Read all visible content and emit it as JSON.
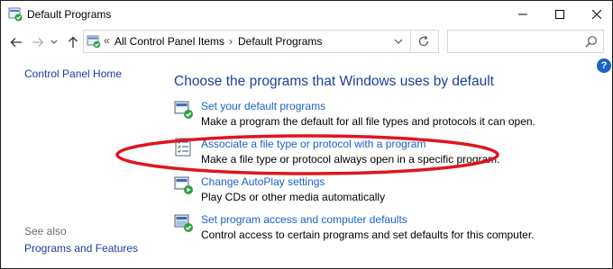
{
  "window": {
    "title": "Default Programs"
  },
  "address": {
    "overflow": "«",
    "crumbs": [
      "All Control Panel Items",
      "Default Programs"
    ],
    "separator": "›",
    "search_placeholder": ""
  },
  "help": {
    "label": "?"
  },
  "left_pane": {
    "home_link": "Control Panel Home",
    "see_also_label": "See also",
    "see_also_link": "Programs and Features"
  },
  "main": {
    "heading": "Choose the programs that Windows uses by default",
    "items": [
      {
        "link": "Set your default programs",
        "desc": "Make a program the default for all file types and protocols it can open.",
        "icon": "default-programs-icon"
      },
      {
        "link": "Associate a file type or protocol with a program",
        "desc": "Make a file type or protocol always open in a specific program.",
        "icon": "file-association-icon"
      },
      {
        "link": "Change AutoPlay settings",
        "desc": "Play CDs or other media automatically",
        "icon": "autoplay-icon"
      },
      {
        "link": "Set program access and computer defaults",
        "desc": "Control access to certain programs and set defaults for this computer.",
        "icon": "program-access-icon"
      }
    ]
  },
  "colors": {
    "link": "#1a62c4",
    "heading": "#1e3f9a",
    "highlight": "#e0151d"
  }
}
